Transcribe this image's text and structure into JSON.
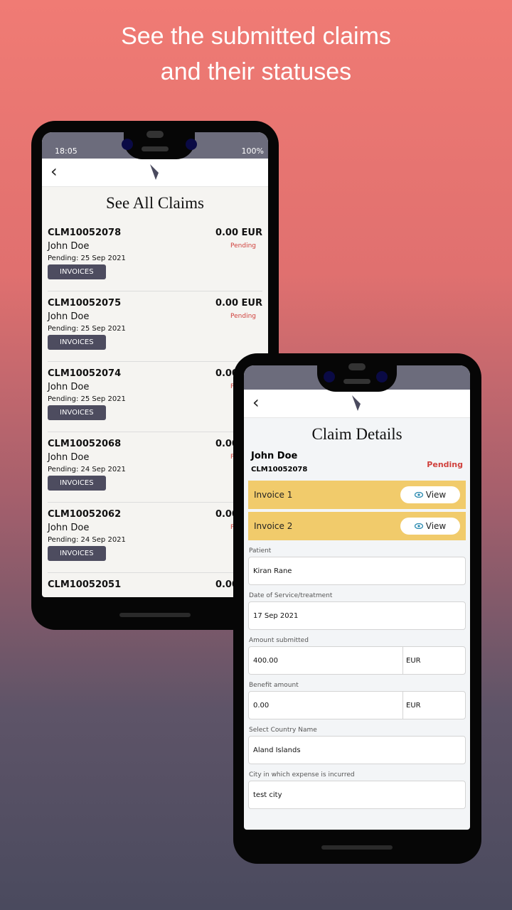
{
  "headline": [
    "See the submitted claims",
    "and their statuses"
  ],
  "list_phone": {
    "status": {
      "time": "18:05",
      "right": "100%"
    },
    "title": "See All Claims",
    "claims": [
      {
        "id": "CLM10052078",
        "name": "John Doe",
        "date": "Pending: 25 Sep 2021",
        "amount": "0.00 EUR",
        "status": "Pending",
        "button": "INVOICES"
      },
      {
        "id": "CLM10052075",
        "name": "John Doe",
        "date": "Pending: 25 Sep 2021",
        "amount": "0.00 EUR",
        "status": "Pending",
        "button": "INVOICES"
      },
      {
        "id": "CLM10052074",
        "name": "John Doe",
        "date": "Pending: 25 Sep 2021",
        "amount": "0.00 EUR",
        "status": "Pending",
        "button": "INVOICES"
      },
      {
        "id": "CLM10052068",
        "name": "John Doe",
        "date": "Pending: 24 Sep 2021",
        "amount": "0.00 EUR",
        "status": "Pending",
        "button": "INVOICES"
      },
      {
        "id": "CLM10052062",
        "name": "John Doe",
        "date": "Pending: 24 Sep 2021",
        "amount": "0.00 EUR",
        "status": "Pending",
        "button": "INVOICES"
      },
      {
        "id": "CLM10052051",
        "name": "",
        "date": "",
        "amount": "0.00 EUR",
        "status": "",
        "button": ""
      }
    ]
  },
  "detail_phone": {
    "status": "Pending",
    "title": "Claim Details",
    "name": "John Doe",
    "id": "CLM10052078",
    "invoices": [
      {
        "label": "Invoice 1",
        "view": "View"
      },
      {
        "label": "Invoice 2",
        "view": "View"
      }
    ],
    "fields": [
      {
        "label": "Patient",
        "value": "Kiran Rane"
      },
      {
        "label": "Date of Service/treatment",
        "value": "17 Sep 2021"
      },
      {
        "label": "Amount submitted",
        "value": "400.00",
        "currency": "EUR"
      },
      {
        "label": "Benefit amount",
        "value": "0.00",
        "currency": "EUR"
      },
      {
        "label": "Select Country Name",
        "value": "Aland Islands"
      },
      {
        "label": "City in which expense is incurred",
        "value": "test city"
      }
    ]
  },
  "colors": {
    "pending": "#d0413d",
    "invoice_bar": "#f1cb6b",
    "button": "#4d4c5f"
  }
}
